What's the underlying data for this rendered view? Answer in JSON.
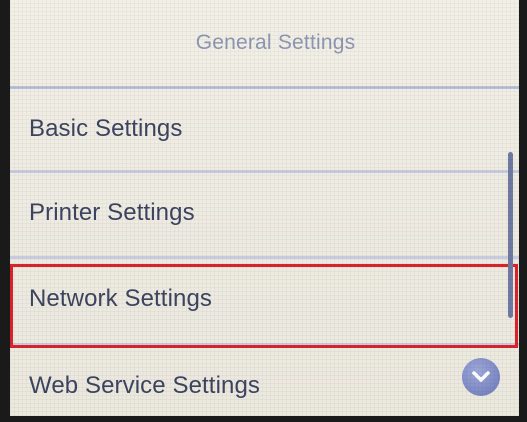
{
  "header": {
    "title": "General Settings"
  },
  "menu": {
    "items": [
      {
        "label": "Basic Settings"
      },
      {
        "label": "Printer Settings"
      },
      {
        "label": "Network Settings",
        "highlighted": true
      },
      {
        "label": "Web Service Settings"
      }
    ]
  },
  "scroll": {
    "down_icon": "chevron-down-icon"
  },
  "colors": {
    "highlight": "#d9232d",
    "title": "#8e97b3",
    "item_text": "#3d4460",
    "scroll_button": "#7f8bc6"
  }
}
